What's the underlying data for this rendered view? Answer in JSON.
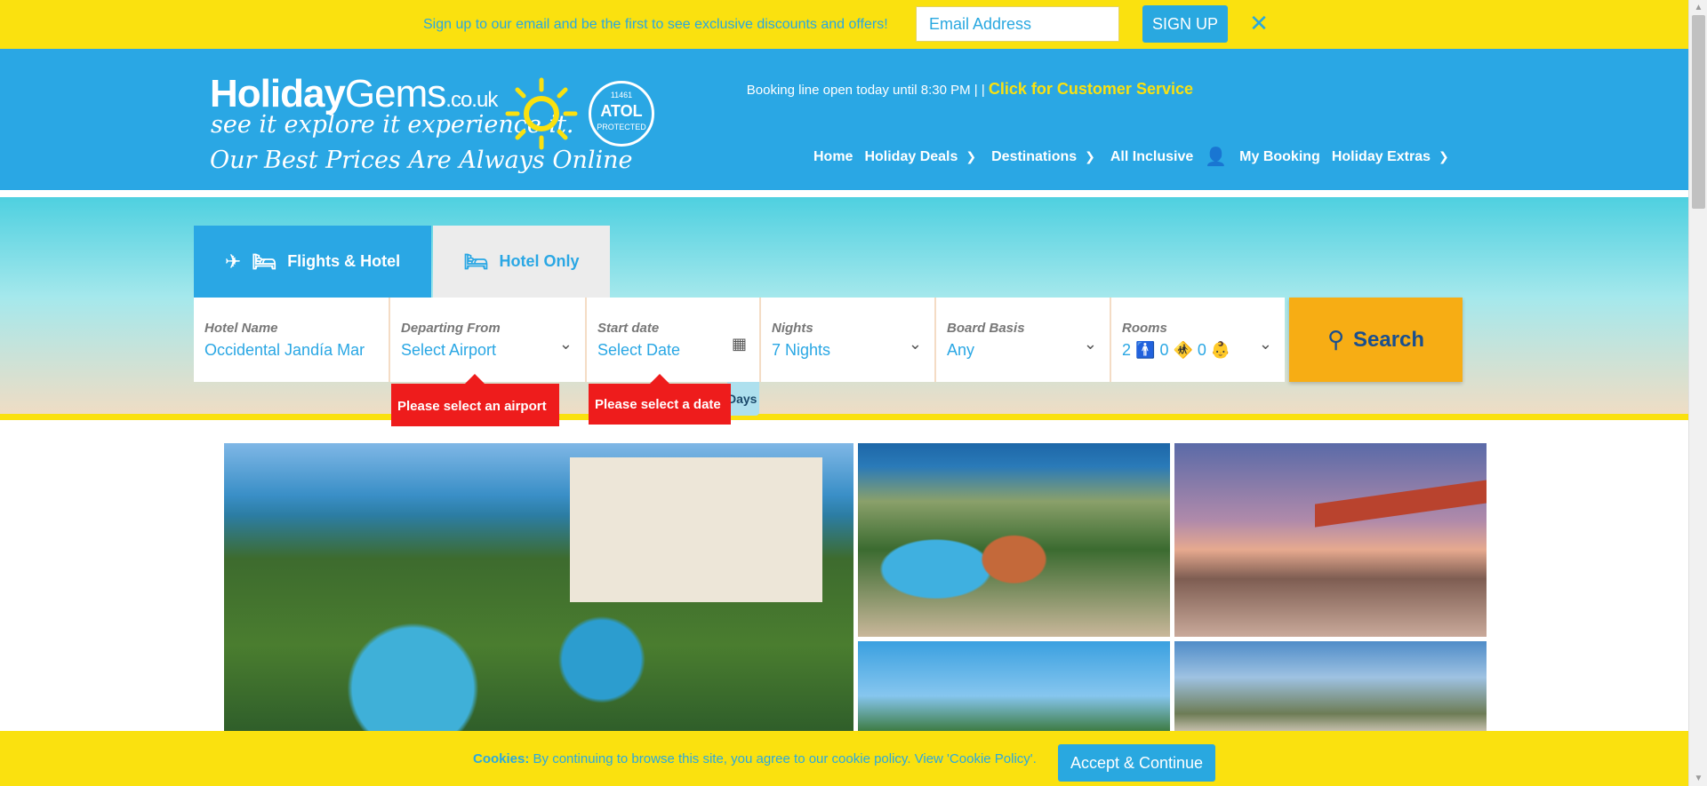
{
  "promo": {
    "text": "Sign up to our email and be the first to see exclusive discounts and offers!",
    "email_placeholder": "Email Address",
    "signup_label": "SIGN UP",
    "close_icon": "close-icon"
  },
  "brand": {
    "name_bold": "Holiday",
    "name_light": "Gems",
    "tld": ".co.uk",
    "slogan": "see it explore it experience it.",
    "tagline": "Our Best Prices Are Always Online",
    "atol_number": "11461",
    "atol_mark": "ATOL",
    "atol_caption": "PROTECTED"
  },
  "booking": {
    "text": "Booking line open today until 8:30 PM | |",
    "customer_service": "Click for Customer Service"
  },
  "nav": {
    "home": "Home",
    "holiday_deals": "Holiday Deals",
    "destinations": "Destinations",
    "all_inclusive": "All Inclusive",
    "my_booking": "My Booking",
    "holiday_extras": "Holiday Extras"
  },
  "tabs": {
    "flights_hotel": "Flights & Hotel",
    "hotel_only": "Hotel Only"
  },
  "search": {
    "hotel_name_label": "Hotel Name",
    "hotel_name_value": "Occidental Jandía Mar",
    "departing_label": "Departing From",
    "departing_value": "Select Airport",
    "start_label": "Start date",
    "start_value": "Select Date",
    "nights_label": "Nights",
    "nights_value": "7 Nights",
    "board_label": "Board Basis",
    "board_value": "Any",
    "rooms_label": "Rooms",
    "adults": "2",
    "children": "0",
    "infants": "0",
    "button_label": "Search"
  },
  "errors": {
    "airport": "Please select an airport",
    "date": "Please select a date",
    "days_chip": "Days"
  },
  "cookies": {
    "title": "Cookies:",
    "text": "By continuing to browse this site, you agree to our cookie policy. View 'Cookie Policy'.",
    "accept_label": "Accept & Continue"
  },
  "colors": {
    "brand_blue": "#2aa7e4",
    "brand_yellow": "#fae10f",
    "search_orange": "#f7ad14",
    "error_red": "#ee1c1c"
  }
}
